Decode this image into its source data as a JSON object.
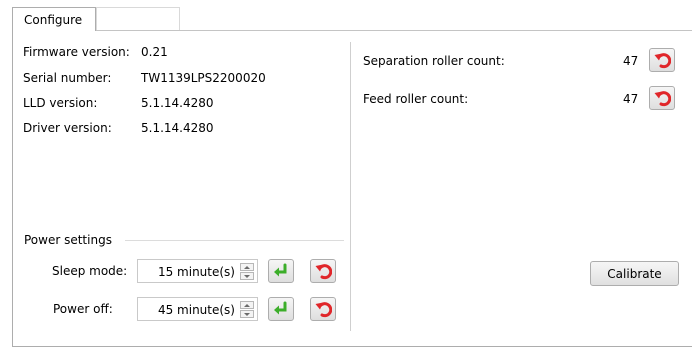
{
  "tabs": [
    {
      "label": "Configure"
    }
  ],
  "info": {
    "firmware_label": "Firmware version:",
    "firmware_value": "0.21",
    "serial_label": "Serial number:",
    "serial_value": "TW1139LPS2200020",
    "lld_label": "LLD version:",
    "lld_value": "5.1.14.4280",
    "driver_label": "Driver version:",
    "driver_value": "5.1.14.4280"
  },
  "power": {
    "heading": "Power settings",
    "sleep_label": "Sleep mode:",
    "sleep_value": "15 minute(s)",
    "off_label": "Power off:",
    "off_value": "45 minute(s)"
  },
  "rollers": {
    "separation_label": "Separation roller count:",
    "separation_value": "47",
    "feed_label": "Feed roller count:",
    "feed_value": "47"
  },
  "calibrate_label": "Calibrate",
  "colors": {
    "apply_icon": "#3cae2a",
    "reset_icon": "#e0262a"
  },
  "icons": {
    "apply": "green-return-arrow-icon",
    "reset": "red-undo-arrow-icon"
  }
}
